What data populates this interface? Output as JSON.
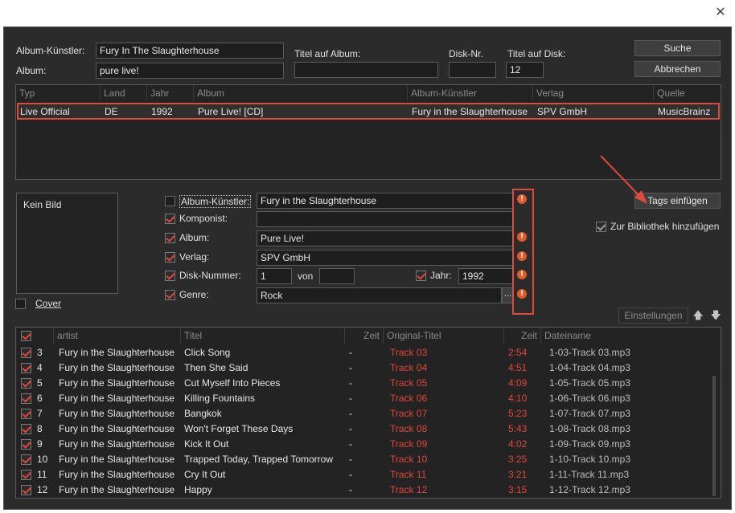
{
  "window": {
    "close_icon": "close-icon"
  },
  "search": {
    "album_artist_label": "Album-Künstler:",
    "album_artist_value": "Fury In The Slaughterhouse",
    "album_label": "Album:",
    "album_value": "pure live!",
    "titles_on_album_label": "Titel auf Album:",
    "titles_on_album_value": "",
    "disc_no_label": "Disk-Nr.",
    "disc_no_value": "",
    "titles_on_disc_label": "Titel auf Disk:",
    "titles_on_disc_value": "12",
    "search_button": "Suche",
    "cancel_button": "Abbrechen"
  },
  "results": {
    "columns": [
      "Typ",
      "Land",
      "Jahr",
      "Album",
      "Album-Künstler",
      "Verlag",
      "Quelle"
    ],
    "rows": [
      {
        "typ": "Live Official",
        "land": "DE",
        "jahr": "1992",
        "album": "Pure Live!  [CD]",
        "album_artist": "Fury in the Slaughterhouse",
        "verlag": "SPV GmbH",
        "quelle": "MusicBrainz"
      }
    ]
  },
  "cover": {
    "no_image": "Kein Bild",
    "cover_label": "Cover"
  },
  "tags": {
    "album_artist": {
      "label": "Album-Künstler:",
      "value": "Fury in the Slaughterhouse",
      "checked": false
    },
    "composer": {
      "label": "Komponist:",
      "value": "",
      "checked": true
    },
    "album": {
      "label": "Album:",
      "value": "Pure Live!",
      "checked": true
    },
    "publisher": {
      "label": "Verlag:",
      "value": "SPV GmbH",
      "checked": true
    },
    "disc_number": {
      "label": "Disk-Nummer:",
      "value": "1",
      "von_label": "von",
      "von_value": "",
      "checked": true
    },
    "year": {
      "label": "Jahr:",
      "value": "1992",
      "checked": true
    },
    "genre": {
      "label": "Genre:",
      "value": "Rock",
      "browse": "...",
      "checked": true
    }
  },
  "actions": {
    "insert_tags_button": "Tags einfügen",
    "add_to_library_label": "Zur Bibliothek hinzufügen",
    "settings_button": "Einstellungen"
  },
  "tracks": {
    "columns": [
      "artist",
      "Titel",
      "Zeit",
      "Original-Titel",
      "Zeit",
      "Dateiname"
    ],
    "rows": [
      {
        "n": "3",
        "artist": "Fury in the Slaughterhouse",
        "title": "Click Song",
        "time": "-",
        "orig": "Track 03",
        "orig_time": "2:54",
        "file": "1-03-Track 03.mp3"
      },
      {
        "n": "4",
        "artist": "Fury in the Slaughterhouse",
        "title": "Then She Said",
        "time": "-",
        "orig": "Track 04",
        "orig_time": "4:51",
        "file": "1-04-Track 04.mp3"
      },
      {
        "n": "5",
        "artist": "Fury in the Slaughterhouse",
        "title": "Cut Myself Into Pieces",
        "time": "-",
        "orig": "Track 05",
        "orig_time": "4:09",
        "file": "1-05-Track 05.mp3"
      },
      {
        "n": "6",
        "artist": "Fury in the Slaughterhouse",
        "title": "Killing Fountains",
        "time": "-",
        "orig": "Track 06",
        "orig_time": "4:10",
        "file": "1-06-Track 06.mp3"
      },
      {
        "n": "7",
        "artist": "Fury in the Slaughterhouse",
        "title": "Bangkok",
        "time": "-",
        "orig": "Track 07",
        "orig_time": "5:23",
        "file": "1-07-Track 07.mp3"
      },
      {
        "n": "8",
        "artist": "Fury in the Slaughterhouse",
        "title": "Won't Forget These Days",
        "time": "-",
        "orig": "Track 08",
        "orig_time": "5:43",
        "file": "1-08-Track 08.mp3"
      },
      {
        "n": "9",
        "artist": "Fury in the Slaughterhouse",
        "title": "Kick It Out",
        "time": "-",
        "orig": "Track 09",
        "orig_time": "4:02",
        "file": "1-09-Track 09.mp3"
      },
      {
        "n": "10",
        "artist": "Fury in the Slaughterhouse",
        "title": "Trapped Today, Trapped Tomorrow",
        "time": "-",
        "orig": "Track 10",
        "orig_time": "3:25",
        "file": "1-10-Track 10.mp3"
      },
      {
        "n": "11",
        "artist": "Fury in the Slaughterhouse",
        "title": "Cry It Out",
        "time": "-",
        "orig": "Track 11",
        "orig_time": "3:21",
        "file": "1-11-Track 11.mp3"
      },
      {
        "n": "12",
        "artist": "Fury in the Slaughterhouse",
        "title": "Happy",
        "time": "-",
        "orig": "Track 12",
        "orig_time": "3:15",
        "file": "1-12-Track 12.mp3"
      }
    ]
  },
  "colors": {
    "accent_red": "#e0463a",
    "background": "#2b2b2b",
    "warning": "#e35a2a"
  }
}
